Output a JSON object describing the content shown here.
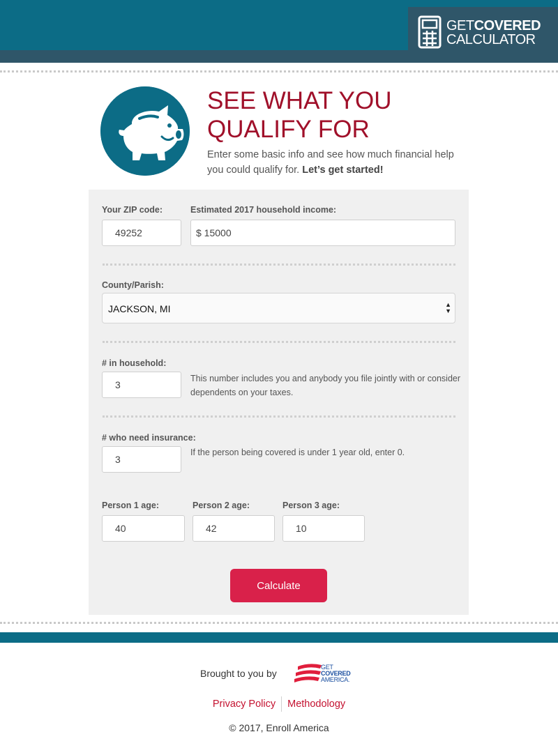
{
  "header": {
    "logo_line1_light": "GET",
    "logo_line1_bold": "COVERED",
    "logo_line2": "CALCULATOR",
    "icon": "calculator-icon"
  },
  "hero": {
    "icon": "piggy-bank-icon",
    "title_line1": "SEE WHAT YOU",
    "title_line2": "QUALIFY FOR",
    "intro": "Enter some basic info and see how much financial help you could qualify for.",
    "intro_bold": "Let’s get started!"
  },
  "form": {
    "zip_label": "Your ZIP code:",
    "zip_value": "49252",
    "income_label": "Estimated 2017 household income:",
    "income_value": "$ 15000",
    "county_label": "County/Parish:",
    "county_value": "JACKSON, MI",
    "household_label": "# in household:",
    "household_value": "3",
    "household_help": "This number includes you and anybody you file jointly with or consider dependents on your taxes.",
    "insured_label": "# who need insurance:",
    "insured_value": "3",
    "insured_help": "If the person being covered is under 1 year old, enter 0.",
    "ages": [
      {
        "label": "Person 1 age:",
        "value": "40"
      },
      {
        "label": "Person 2 age:",
        "value": "42"
      },
      {
        "label": "Person 3 age:",
        "value": "10"
      }
    ],
    "calculate_label": "Calculate"
  },
  "footer": {
    "brought_by": "Brought to you by",
    "partner_line1": "GET",
    "partner_line2": "COVERED",
    "partner_line3": "AMERICA.",
    "privacy_label": "Privacy Policy",
    "methodology_label": "Methodology",
    "copyright": "© 2017, Enroll America"
  },
  "colors": {
    "brand_teal": "#0c6c86",
    "brand_dark": "#2f5669",
    "headline_red": "#a0102a",
    "button_red": "#d9214a"
  }
}
